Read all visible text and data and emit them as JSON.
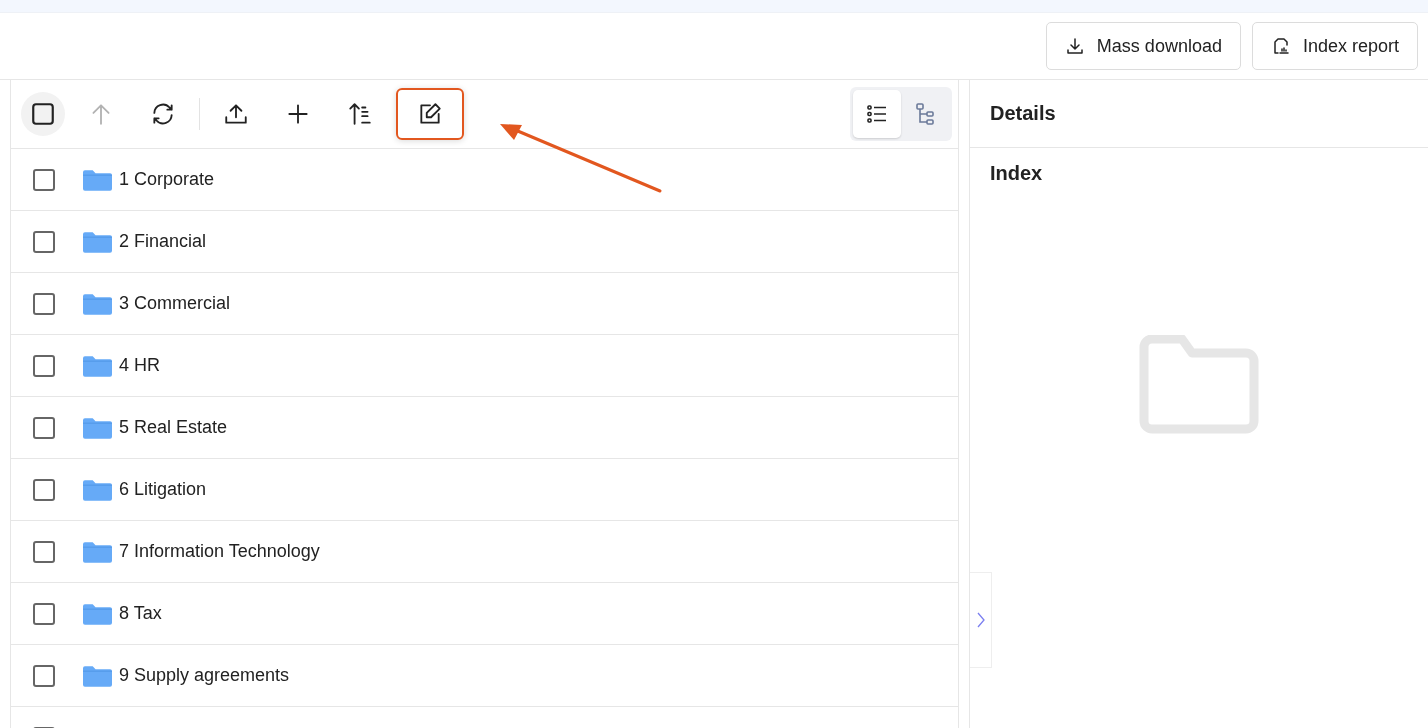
{
  "header": {
    "buttons": [
      {
        "kind": "download",
        "label": "Mass download"
      },
      {
        "kind": "report",
        "label": "Index report"
      }
    ]
  },
  "toolbar": {
    "tools": [
      {
        "kind": "select-all",
        "checked": false,
        "disabled": false,
        "highlighted": false
      },
      {
        "kind": "up",
        "disabled": true,
        "highlighted": false
      },
      {
        "kind": "refresh",
        "disabled": false,
        "highlighted": false
      },
      {
        "kind": "divider"
      },
      {
        "kind": "upload",
        "disabled": false,
        "highlighted": false
      },
      {
        "kind": "add",
        "disabled": false,
        "highlighted": false
      },
      {
        "kind": "sort",
        "disabled": false,
        "highlighted": false
      },
      {
        "kind": "edit",
        "disabled": false,
        "highlighted": true
      }
    ],
    "views": [
      {
        "kind": "list",
        "selected": true
      },
      {
        "kind": "tree",
        "selected": false
      }
    ]
  },
  "folders": [
    {
      "name": "1 Corporate",
      "checked": false
    },
    {
      "name": "2 Financial",
      "checked": false
    },
    {
      "name": "3 Commercial",
      "checked": false
    },
    {
      "name": "4 HR",
      "checked": false
    },
    {
      "name": "5 Real Estate",
      "checked": false
    },
    {
      "name": "6 Litigation",
      "checked": false
    },
    {
      "name": "7 Information Technology",
      "checked": false
    },
    {
      "name": "8 Tax",
      "checked": false
    },
    {
      "name": "9 Supply agreements",
      "checked": false
    },
    {
      "checked": false
    }
  ],
  "details": {
    "title": "Details",
    "section": "Index"
  }
}
